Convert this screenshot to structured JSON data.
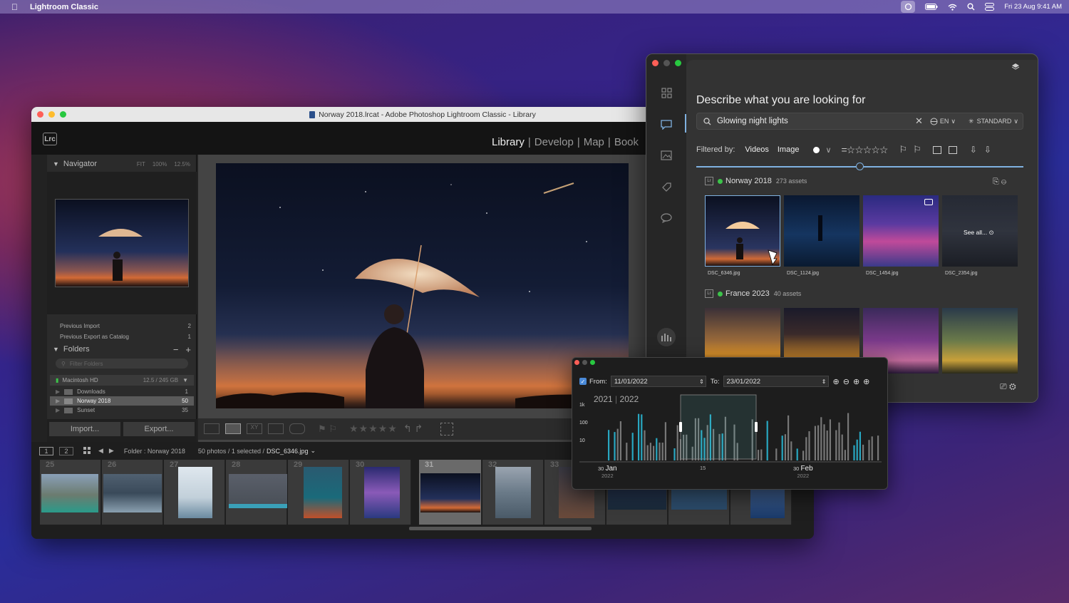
{
  "menubar": {
    "app": "Lightroom Classic",
    "datetime": "Fri 23 Aug  9:41 AM"
  },
  "lr": {
    "title": "Norway 2018.lrcat - Adobe Photoshop Lightroom Classic - Library",
    "logo": "Lrc",
    "modules": [
      "Library",
      "Develop",
      "Map",
      "Book"
    ],
    "navigator": {
      "label": "Navigator",
      "zoom": [
        "FIT",
        "100%",
        "12.5%"
      ]
    },
    "collections": [
      {
        "label": "Previous Import",
        "count": "2"
      },
      {
        "label": "Previous Export as Catalog",
        "count": "1"
      }
    ],
    "folders": {
      "label": "Folders",
      "search_placeholder": "Filter Folders",
      "volume": "Macintosh HD",
      "volume_size": "12.5 / 245 GB",
      "items": [
        {
          "label": "Downloads",
          "count": "1"
        },
        {
          "label": "Norway 2018",
          "count": "50"
        },
        {
          "label": "Sunset",
          "count": "35"
        }
      ]
    },
    "import_label": "Import...",
    "export_label": "Export...",
    "status": {
      "view1": "1",
      "view2": "2",
      "folder": "Folder : Norway 2018",
      "count": "50 photos / 1 selected /",
      "file": "DSC_6346.jpg"
    },
    "filmstrip_numbers": [
      "25",
      "26",
      "27",
      "28",
      "29",
      "30",
      "31",
      "32",
      "33"
    ]
  },
  "ai": {
    "heading": "Describe what you are looking for",
    "query": "Glowing night lights",
    "lang": "EN",
    "mode": "STANDARD",
    "filter_label": "Filtered by:",
    "filter_videos": "Videos",
    "filter_image": "Image",
    "groups": [
      {
        "name": "Norway 2018",
        "count": "273 assets",
        "files": [
          "DSC_6346.jpg",
          "DSC_1124.jpg",
          "DSC_1454.jpg",
          "DSC_2354.jpg"
        ],
        "see_all": "See all..."
      },
      {
        "name": "France 2023",
        "count": "40 assets"
      }
    ]
  },
  "timeline": {
    "from_label": "From:",
    "from": "11/01/2022",
    "to_label": "To:",
    "to": "23/01/2022",
    "years": [
      "2021",
      "2022"
    ],
    "yticks": [
      "1k",
      "100",
      "10"
    ],
    "xlabels": [
      {
        "day": "30",
        "month": "Jan",
        "year": "2022"
      },
      {
        "day": "15",
        "month": "",
        "year": ""
      },
      {
        "day": "30",
        "month": "Feb",
        "year": "2022"
      }
    ]
  },
  "colors": {
    "accent": "#7fb1e0",
    "green": "#3cc34a",
    "teal": "#28a7c1"
  }
}
